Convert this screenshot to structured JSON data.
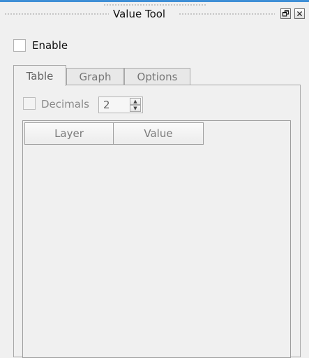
{
  "window": {
    "title": "Value Tool",
    "float_button": "🗗",
    "close_button": "✕"
  },
  "enable": {
    "label": "Enable",
    "checked": false
  },
  "tabs": [
    {
      "label": "Table",
      "active": true
    },
    {
      "label": "Graph",
      "active": false
    },
    {
      "label": "Options",
      "active": false
    }
  ],
  "decimals": {
    "label": "Decimals",
    "checked": false,
    "value": "2",
    "up": "▲",
    "down": "▼"
  },
  "table": {
    "columns": [
      "Layer",
      "Value"
    ]
  },
  "colors": {
    "accent": "#3f8fd6",
    "panel_bg": "#f0f0f0"
  }
}
